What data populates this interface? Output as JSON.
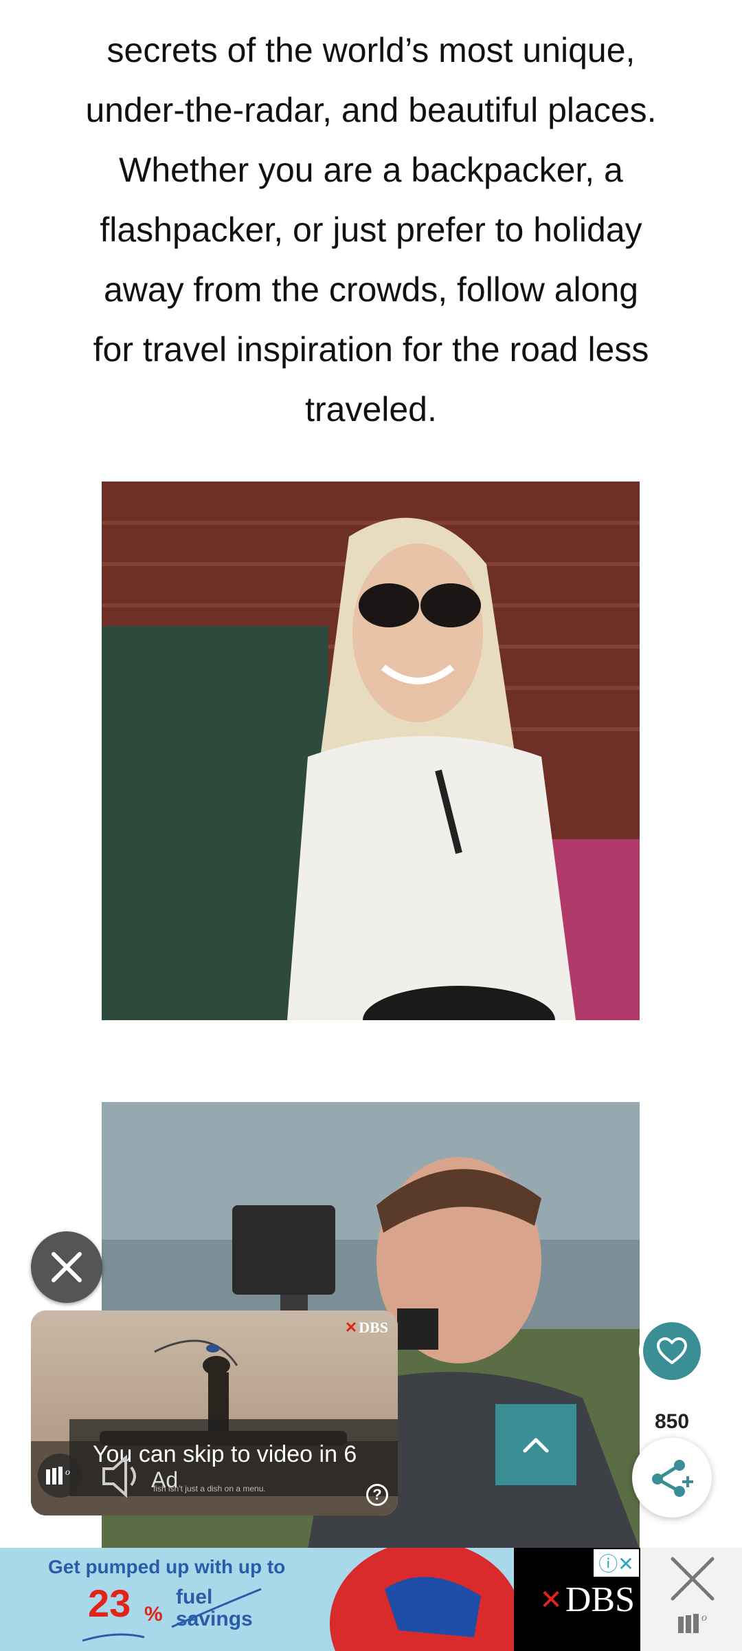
{
  "intro": {
    "lines": [
      "secrets of the world’s most unique,",
      "under-the-radar, and beautiful places.",
      "Whether you are a backpacker, a",
      "flashpacker, or just prefer to holiday",
      "away from the crowds, follow along",
      "for travel inspiration for the road less",
      "traveled."
    ]
  },
  "video_ad": {
    "brand": "DBS",
    "skip_text": "You can skip to video in 6",
    "ad_label": "Ad",
    "sub_text": "fish isn't just a dish on a menu."
  },
  "share": {
    "count": "850"
  },
  "banner_ad": {
    "title": "Get pumped up with up to",
    "percent": "23",
    "percent_sign": "%",
    "fuel": "fuel",
    "savings": "savings",
    "brand": "DBS"
  },
  "colors": {
    "teal": "#3a8f97",
    "dbs_red": "#e2231a",
    "banner_blue": "#2a5ca8"
  }
}
